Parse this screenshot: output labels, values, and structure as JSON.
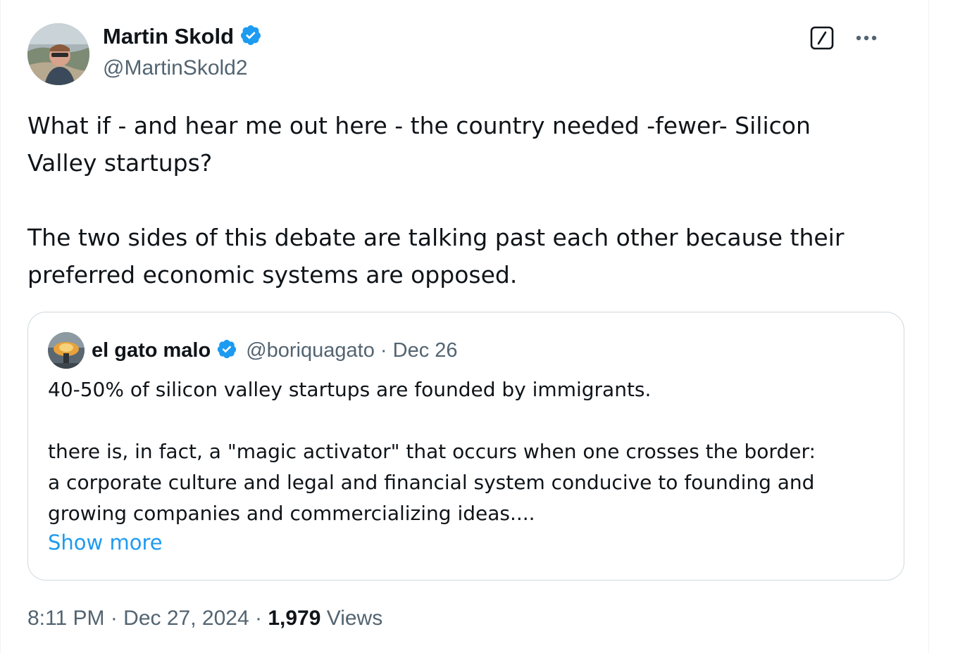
{
  "author": {
    "name": "Martin Skold",
    "handle": "@MartinSkold2",
    "verified": true
  },
  "tweet": {
    "text": "What if - and hear me out here - the country needed -fewer- Silicon\nValley startups?\n\nThe two sides of this debate are talking past each other because their\npreferred economic systems are opposed."
  },
  "quoted": {
    "name": "el gato malo",
    "handle": "@boriquagato",
    "separator": "·",
    "date": "Dec 26",
    "text": "40-50% of silicon valley startups are founded by immigrants.\n\nthere is, in fact, a \"magic activator\" that occurs when one crosses the border:\na corporate culture and legal and financial system conducive to founding and\ngrowing companies and commercializing ideas....",
    "show_more": "Show more"
  },
  "footer": {
    "time": "8:11 PM",
    "sep1": " · ",
    "date": "Dec 27, 2024",
    "sep2": " · ",
    "views_count": "1,979",
    "views_label": " Views"
  },
  "icons": {
    "verified": "verified-badge-icon",
    "grok": "grok-icon",
    "more": "more-icon"
  },
  "colors": {
    "accent": "#1d9bf0",
    "secondary_text": "#536471",
    "border": "#cfd9de"
  }
}
